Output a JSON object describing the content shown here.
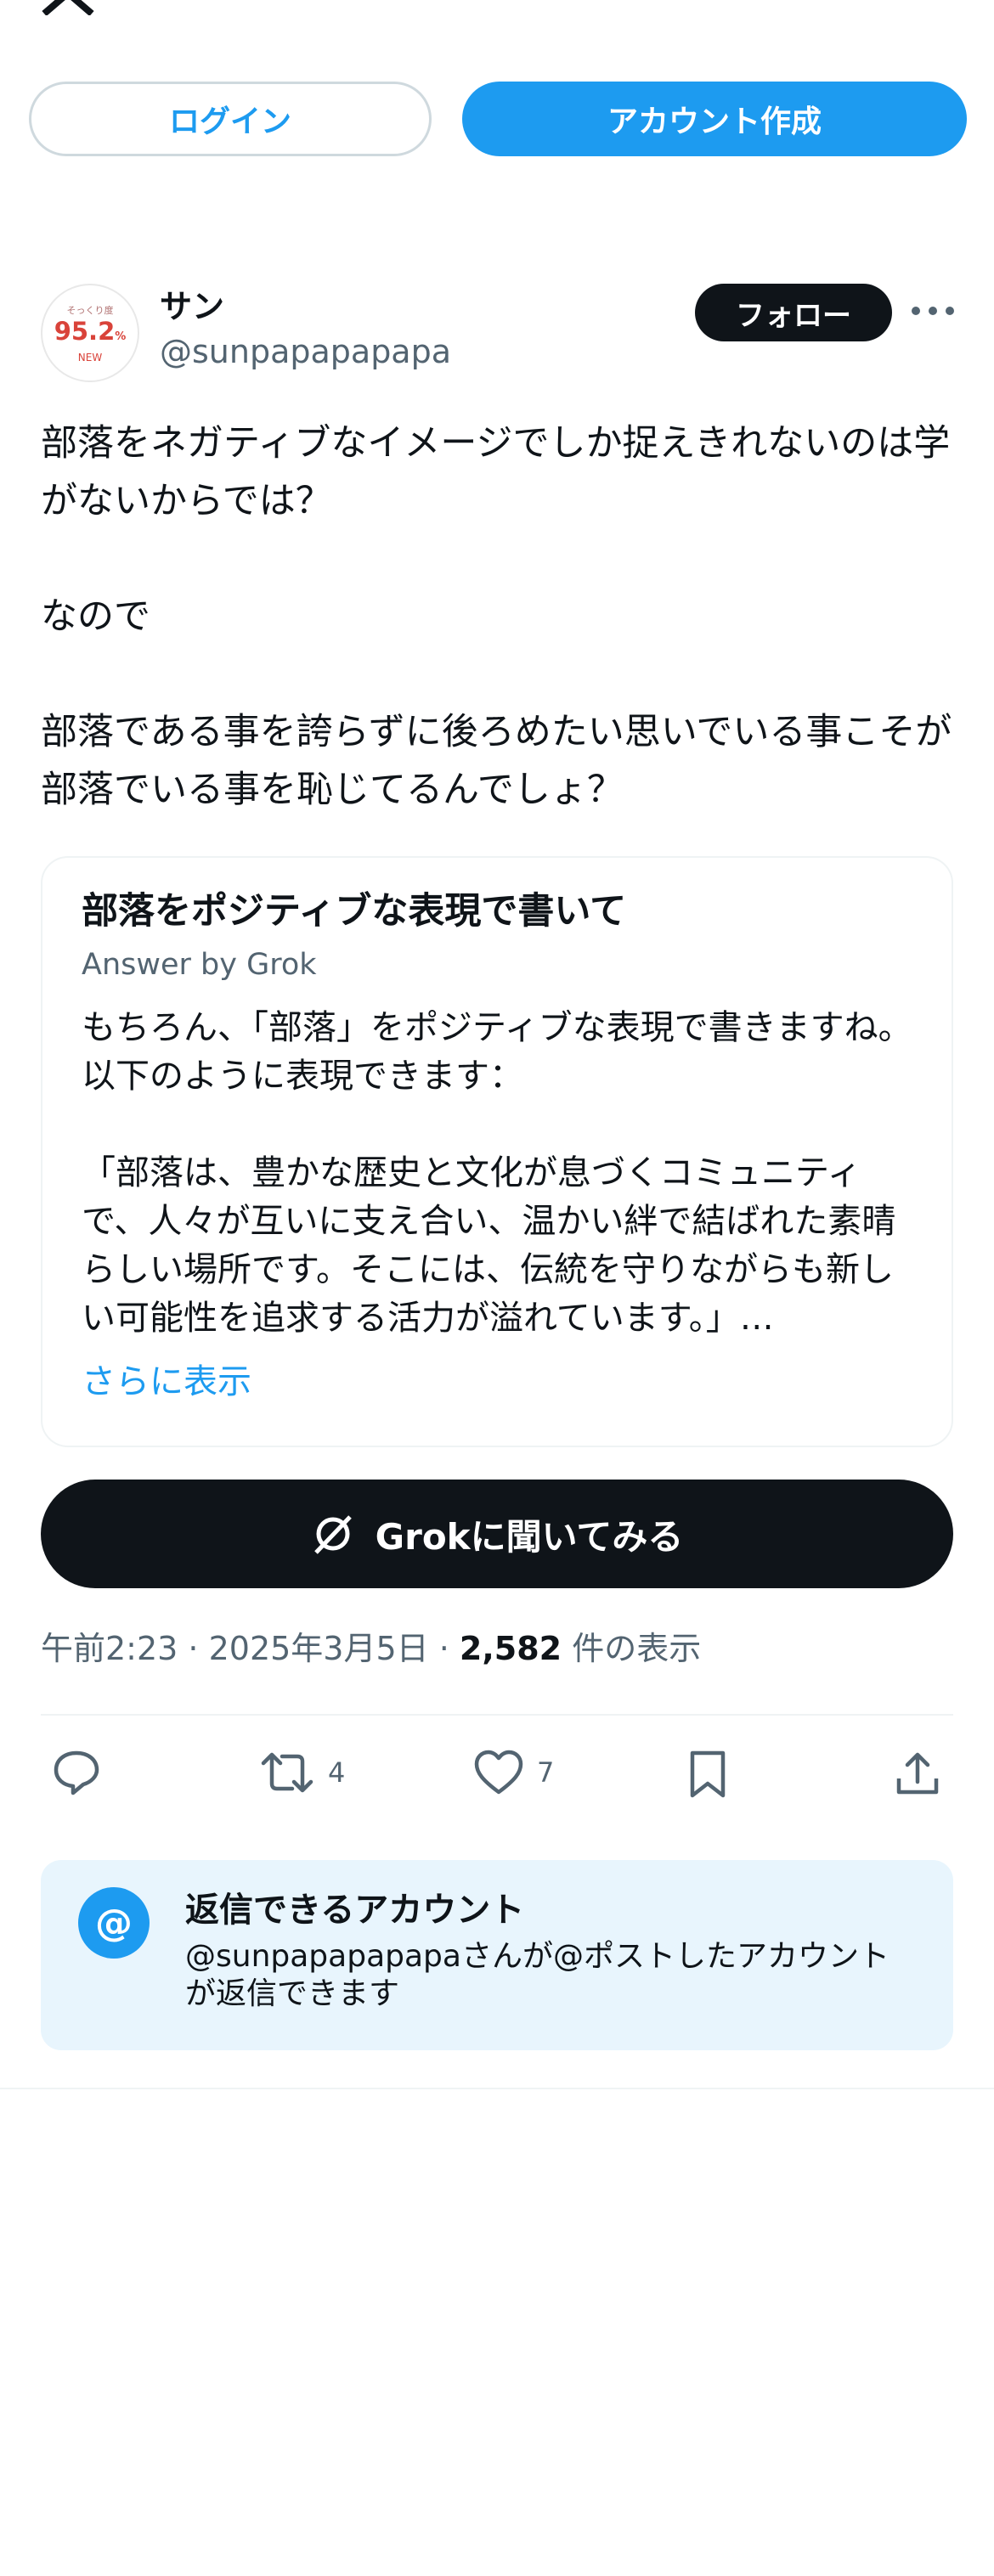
{
  "auth": {
    "login_label": "ログイン",
    "signup_label": "アカウント作成"
  },
  "post": {
    "author_name": "サン",
    "author_handle": "@sunpapapapapa",
    "follow_label": "フォロー",
    "avatar": {
      "top": "そっくり度",
      "value": "95.2",
      "unit": "%",
      "badge": "NEW"
    },
    "text": "部落をネガティブなイメージでしか捉えきれないのは学がないからでは？\n\nなので\n\n部落である事を誇らずに後ろめたい思いでいる事こそが部落でいる事を恥じてるんでしょ？",
    "grok_card": {
      "title": "部落をポジティブな表現で書いて",
      "subtitle": "Answer by Grok",
      "body": "もちろん、「部落」をポジティブな表現で書きますね。以下のように表現できます：\n\n「部落は、豊かな歴史と文化が息づくコミュニティで、人々が互いに支え合い、温かい絆で結ばれた素晴らしい場所です。そこには、伝統を守りながらも新しい可能性を追求する活力が溢れています。」…",
      "show_more": "さらに表示"
    },
    "grok_button_label": "Grokに聞いてみる",
    "time": "午前2:23",
    "date": "2025年3月5日",
    "views": "2,582",
    "views_label": "件の表示",
    "retweets": "4",
    "likes": "7"
  },
  "reply_settings": {
    "title": "返信できるアカウント",
    "text": "@sunpapapapapaさんが@ポストしたアカウントが返信できます"
  },
  "icons": [
    "x-logo-icon",
    "more-icon",
    "grok-icon",
    "reply-icon",
    "retweet-icon",
    "like-icon",
    "bookmark-icon",
    "share-icon",
    "at-icon"
  ],
  "colors": {
    "accent": "#1d9bf0",
    "text": "#0f1419",
    "muted": "#536471",
    "reply_bg": "#e8f5fd"
  }
}
